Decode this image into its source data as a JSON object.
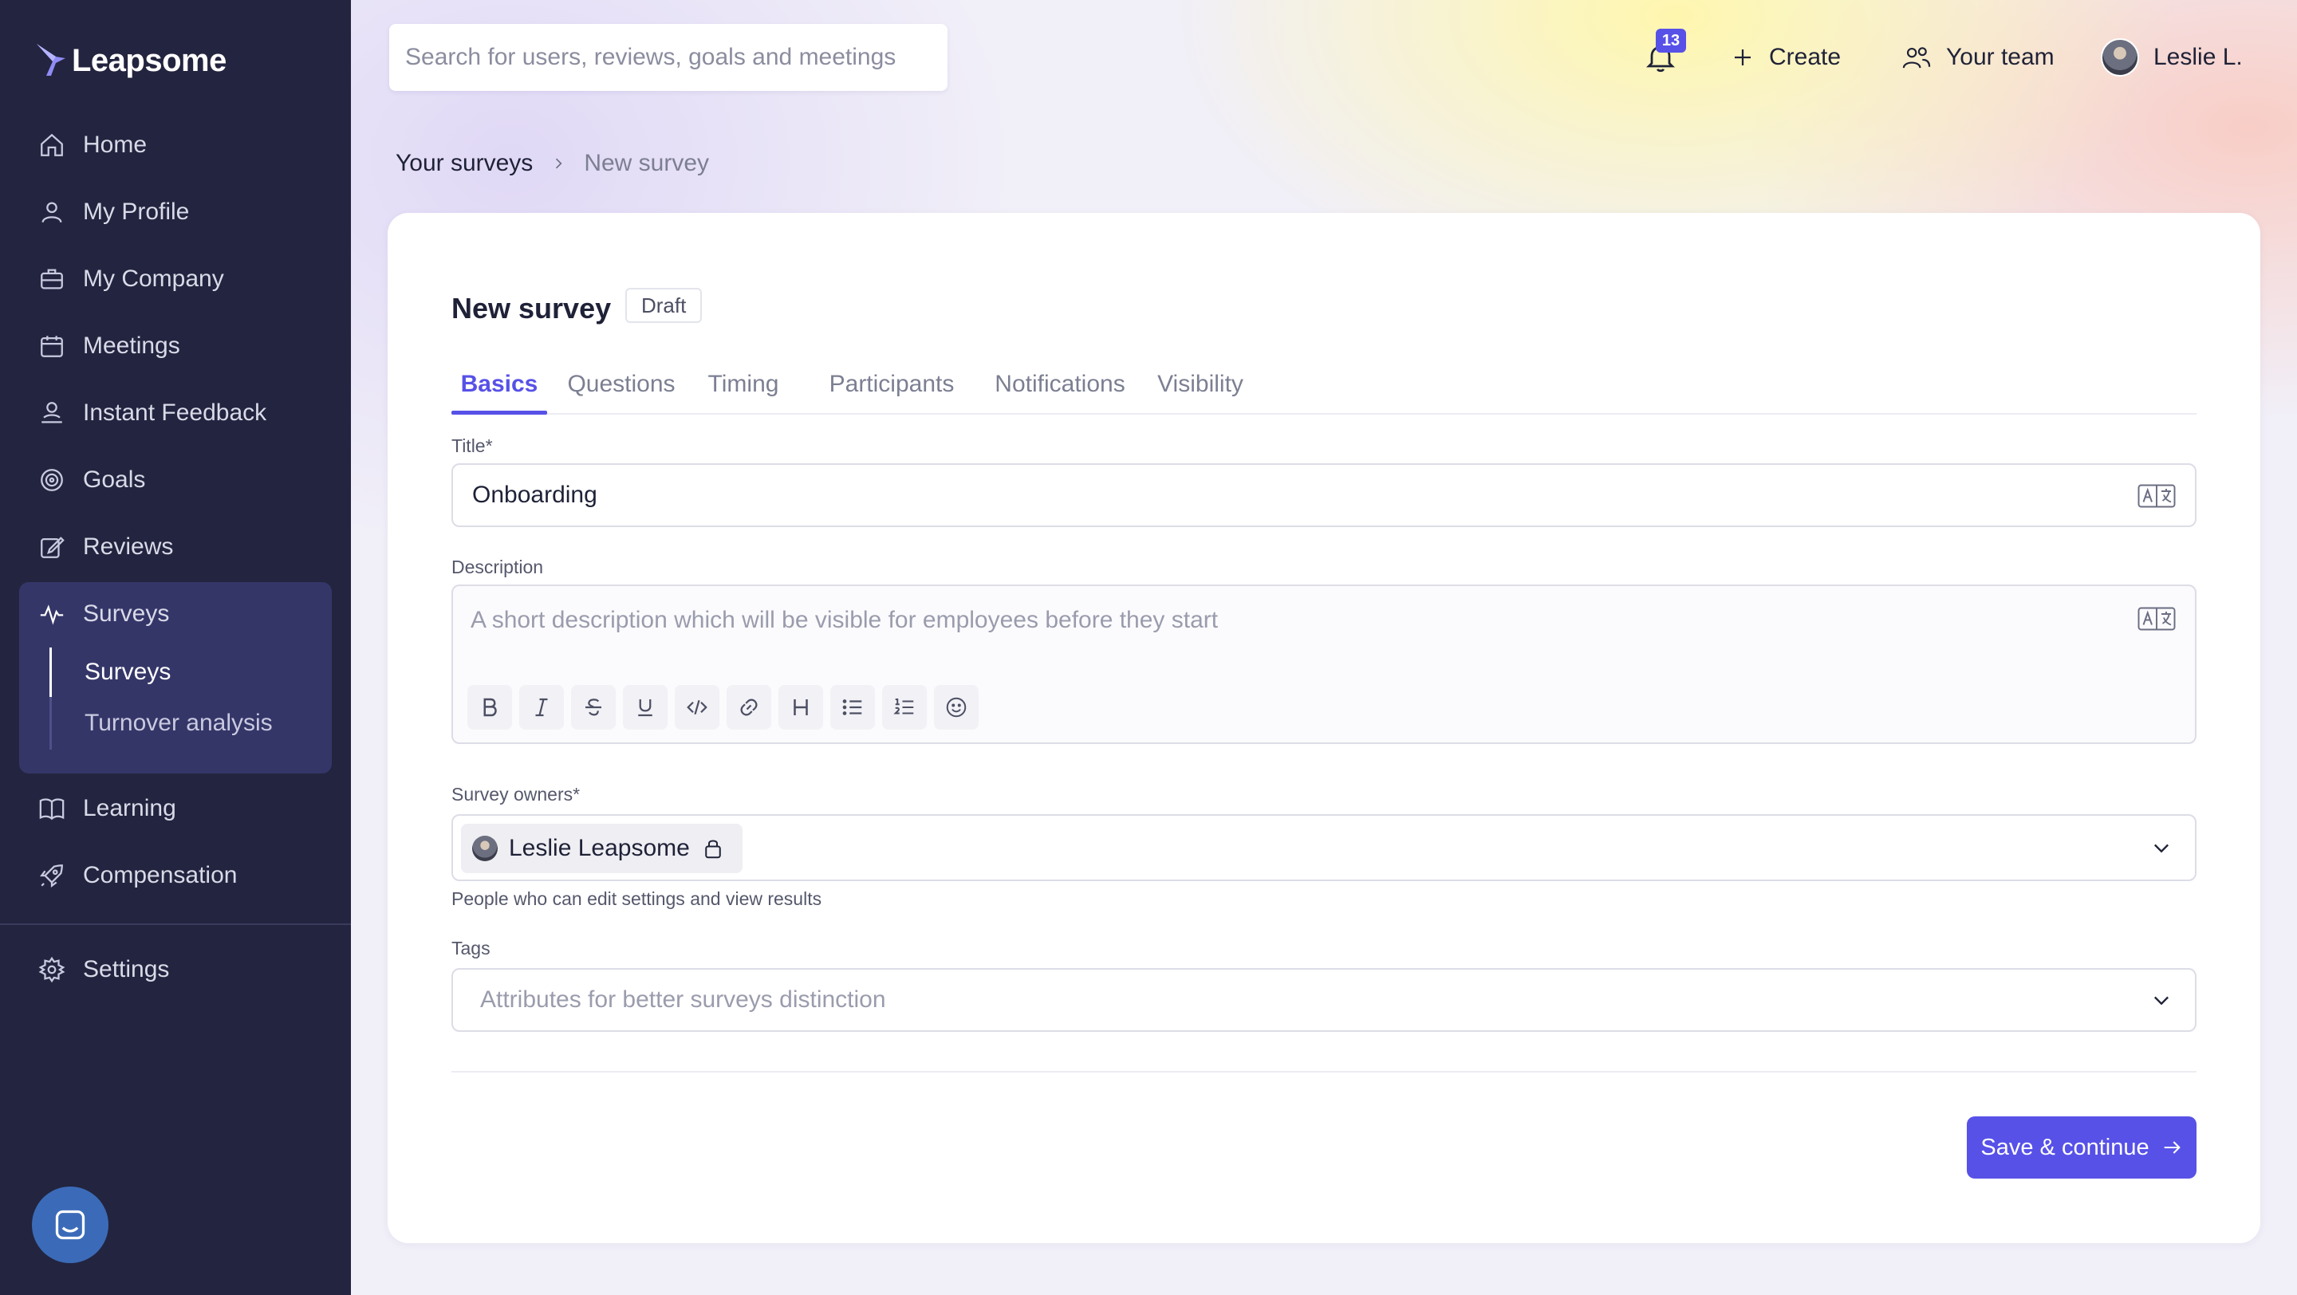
{
  "app": {
    "name": "Leapsome"
  },
  "colors": {
    "sidebar": "#23243f",
    "accent": "#5751e8",
    "active_group": "#353668"
  },
  "sidebar": {
    "items": [
      {
        "label": "Home",
        "icon": "home-icon"
      },
      {
        "label": "My Profile",
        "icon": "user-icon"
      },
      {
        "label": "My Company",
        "icon": "briefcase-icon"
      },
      {
        "label": "Meetings",
        "icon": "calendar-icon"
      },
      {
        "label": "Instant Feedback",
        "icon": "feedback-icon"
      },
      {
        "label": "Goals",
        "icon": "target-icon"
      },
      {
        "label": "Reviews",
        "icon": "edit-icon"
      },
      {
        "label": "Surveys",
        "icon": "pulse-icon"
      },
      {
        "label": "Learning",
        "icon": "book-icon"
      },
      {
        "label": "Compensation",
        "icon": "rocket-icon"
      },
      {
        "label": "Settings",
        "icon": "gear-icon"
      }
    ],
    "sub_items": [
      {
        "label": "Surveys",
        "active": true
      },
      {
        "label": "Turnover analysis",
        "active": false
      }
    ]
  },
  "topbar": {
    "search_placeholder": "Search for users, reviews, goals and meetings",
    "notification_count": "13",
    "create_label": "Create",
    "team_label": "Your team",
    "user_name": "Leslie L."
  },
  "breadcrumb": {
    "parent": "Your surveys",
    "current": "New survey"
  },
  "page": {
    "title": "New survey",
    "status": "Draft"
  },
  "tabs": [
    {
      "label": "Basics",
      "active": true
    },
    {
      "label": "Questions",
      "active": false
    },
    {
      "label": "Timing",
      "active": false
    },
    {
      "label": "Participants",
      "active": false
    },
    {
      "label": "Notifications",
      "active": false
    },
    {
      "label": "Visibility",
      "active": false
    }
  ],
  "form": {
    "title_label": "Title*",
    "title_value": "Onboarding",
    "description_label": "Description",
    "description_placeholder": "A short description which will be visible for employees before they start",
    "owners_label": "Survey owners*",
    "owner_name": "Leslie Leapsome",
    "owners_help": "People who can edit settings and view results",
    "tags_label": "Tags",
    "tags_placeholder": "Attributes for better surveys distinction"
  },
  "toolbar_icons": [
    "bold-icon",
    "italic-icon",
    "strikethrough-icon",
    "underline-icon",
    "code-icon",
    "link-icon",
    "heading-icon",
    "bullet-list-icon",
    "numbered-list-icon",
    "emoji-icon"
  ],
  "actions": {
    "save_label": "Save & continue"
  }
}
